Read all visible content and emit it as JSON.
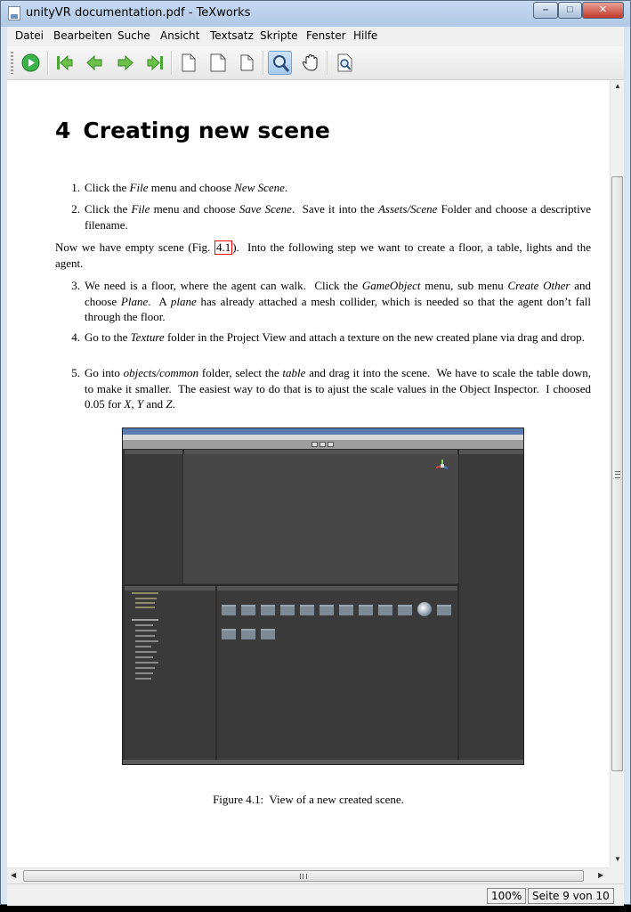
{
  "window": {
    "title": "unityVR documentation.pdf - TeXworks",
    "controls": {
      "minimize": "–",
      "maximize": "□",
      "close": "✕"
    }
  },
  "menu": [
    "Datei",
    "Bearbeiten",
    "Suche",
    "Ansicht",
    "Textsatz",
    "Skripte",
    "Fenster",
    "Hilfe"
  ],
  "toolbar": {
    "buttons": [
      "typeset-icon",
      "first-page-icon",
      "previous-page-icon",
      "next-page-icon",
      "last-page-icon",
      "actual-size-icon",
      "fit-width-icon",
      "fit-window-icon",
      "magnifier-icon",
      "hand-tool-icon",
      "find-icon"
    ],
    "colors": {
      "typeset": "#3cb34a",
      "nav_arrows": "#4ba636",
      "active_tool_bg": "#b6d3f1"
    }
  },
  "document": {
    "chapter_number": "4",
    "chapter_title": "Creating new scene",
    "items": [
      {
        "num": "1.",
        "html": "Click the <i>File</i> menu and choose <i>New Scene</i>."
      },
      {
        "num": "2.",
        "html": "Click the <i>File</i> menu and choose <i>Save Scene</i>.&nbsp; Save it into the <i>Assets/Scene</i> Folder and choose a descriptive filename."
      }
    ],
    "paragraph_before": "Now we have empty scene (Fig.",
    "figure_ref": "4.1",
    "paragraph_after": ").&nbsp; Into the following step we want to create a floor, a table, lights and the agent.",
    "items2": [
      {
        "num": "3.",
        "html": "We need is a floor, where the agent can walk.&nbsp; Click the <i>GameObject</i> menu, sub menu <i>Create Other</i> and choose <i>Plane</i>.&nbsp; A <i>plane</i> has already attached a mesh collider, which is needed so that the agent don’t fall through the floor."
      },
      {
        "num": "4.",
        "html": "Go to the <i>Texture</i> folder in the Project View and attach a texture on the new created plane via drag and drop."
      },
      {
        "num": "5.",
        "html": "Go into <i>objects/common</i> folder, select the <i>table</i> and drag it into the scene.&nbsp; We have to scale the table down, to make it smaller.&nbsp; The easiest way to do that is to ajust the scale values in the Object Inspector.&nbsp; I choosed 0.05 for <i>X</i>, <i>Y</i> and <i>Z</i>."
      }
    ],
    "figure_caption": "Figure 4.1:&nbsp; View of a new created scene."
  },
  "status": {
    "zoom": "100%",
    "page": "Seite 9 von 10"
  }
}
